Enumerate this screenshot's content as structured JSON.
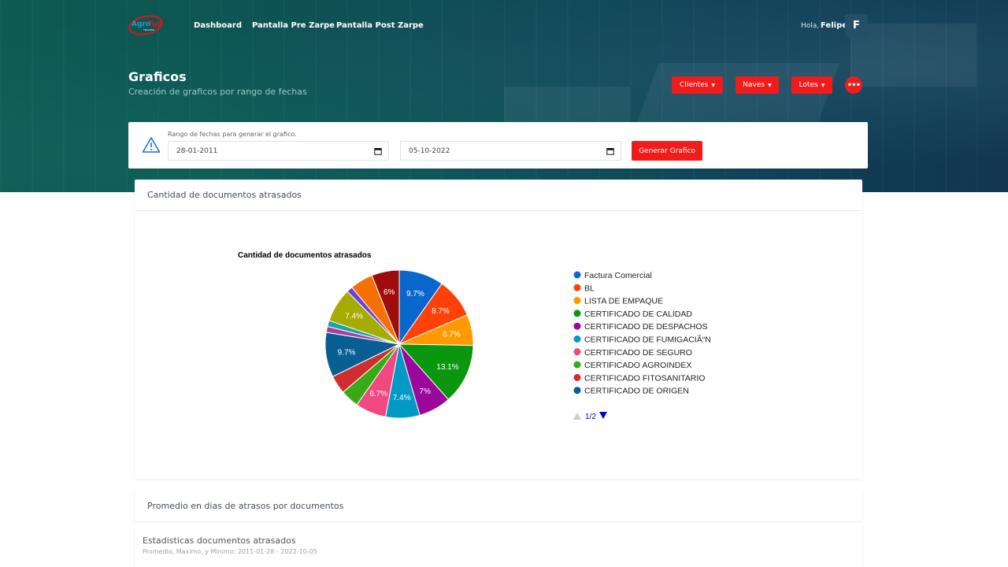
{
  "nav": {
    "logo_text_1": "Agro",
    "logo_text_2": "Tup",
    "logo_sub": "TRACKER",
    "links": [
      "Dashboard",
      "Pantalla Pre Zarpe",
      "Pantalla Post Zarpe"
    ],
    "hello": "Hola,",
    "user_name": "Felipe",
    "avatar_initial": "F"
  },
  "header": {
    "title": "Graficos",
    "subtitle": "Creación de graficos por rango de fechas",
    "buttons": [
      "Clientes",
      "Naves",
      "Lotes"
    ],
    "more": "•••"
  },
  "filter": {
    "label": "Rango de fechas para generar el grafico.",
    "date_from": "28-01-2011",
    "date_to": "05-10-2022",
    "generate_label": "Generar Grafico"
  },
  "colors": {
    "accent": "#f01c1c"
  },
  "chart_card": {
    "header": "Cantidad de documentos atrasados"
  },
  "chart_data": {
    "type": "pie",
    "title": "Cantidad de documentos atrasados",
    "legend_position": "right",
    "legend_page": "1/2",
    "slices": [
      {
        "label": "Factura Comercial",
        "value": 9.7,
        "color": "#0a67ce",
        "text": "9.7%"
      },
      {
        "label": "BL",
        "value": 8.7,
        "color": "#fe4107",
        "text": "8.7%"
      },
      {
        "label": "LISTA DE EMPAQUE",
        "value": 6.7,
        "color": "#fd9a00",
        "text": "6.7%"
      },
      {
        "label": "CERTIFICADO DE CALIDAD",
        "value": 13.1,
        "color": "#0b9610",
        "text": "13.1%"
      },
      {
        "label": "CERTIFICADO DE DESPACHOS",
        "value": 7,
        "color": "#9b069b",
        "text": "7%"
      },
      {
        "label": "CERTIFICADO DE FUMIGACIÃ“N",
        "value": 7.4,
        "color": "#0199c5",
        "text": "7.4%"
      },
      {
        "label": "CERTIFICADO DE SEGURO",
        "value": 6.7,
        "color": "#f24881",
        "text": "6.7%"
      },
      {
        "label": "CERTIFICADO AGROINDEX",
        "value": 4,
        "color": "#37ab16",
        "text": ""
      },
      {
        "label": "CERTIFICADO FITOSANITARIO",
        "value": 4,
        "color": "#d02d2e",
        "text": ""
      },
      {
        "label": "CERTIFICADO DE ORIGEN",
        "value": 9.7,
        "color": "#085f93",
        "text": "9.7%"
      },
      {
        "label": "",
        "value": 1.3,
        "color": "#aa3fa0",
        "text": ""
      },
      {
        "label": "",
        "value": 1.3,
        "color": "#1ba4a4",
        "text": ""
      },
      {
        "label": "",
        "value": 7.4,
        "color": "#a6ab00",
        "text": "7.4%"
      },
      {
        "label": "",
        "value": 1.3,
        "color": "#6a43d8",
        "text": ""
      },
      {
        "label": "",
        "value": 5,
        "color": "#f57107",
        "text": ""
      },
      {
        "label": "",
        "value": 6,
        "color": "#9e0c0c",
        "text": "6%"
      }
    ]
  },
  "stats_card": {
    "header": "Promedio en dias de atrasos por documentos",
    "title": "Estadisticas documentos atrasados",
    "subtitle": "Promedio, Maximo, y Minimo: 2011-01-28 - 2022-10-05"
  }
}
